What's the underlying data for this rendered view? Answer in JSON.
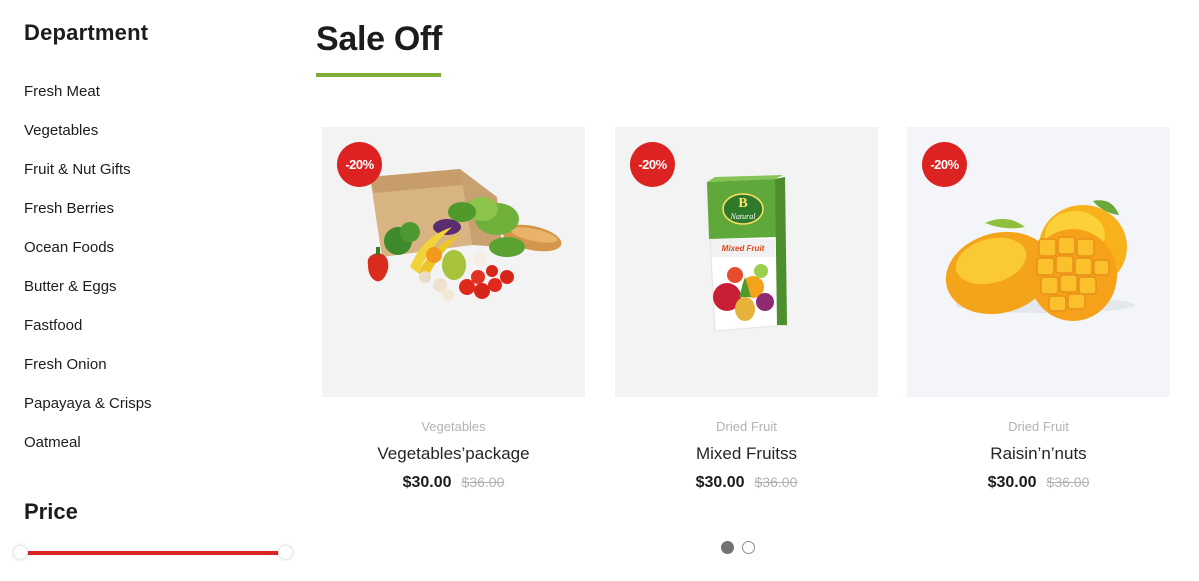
{
  "sidebar": {
    "department_title": "Department",
    "departments": [
      "Fresh Meat",
      "Vegetables",
      "Fruit & Nut Gifts",
      "Fresh Berries",
      "Ocean Foods",
      "Butter & Eggs",
      "Fastfood",
      "Fresh Onion",
      "Papayaya & Crisps",
      "Oatmeal"
    ],
    "price_title": "Price",
    "price_range_fill": 1.0
  },
  "main": {
    "section_title": "Sale Off",
    "products": [
      {
        "discount": "-20%",
        "category": "Vegetables",
        "name": "Vegetables’package",
        "price": "$30.00",
        "old_price": "$36.00",
        "image": "grocery-bag-image"
      },
      {
        "discount": "-20%",
        "category": "Dried Fruit",
        "name": "Mixed Fruitss",
        "price": "$30.00",
        "old_price": "$36.00",
        "image": "juice-carton-image"
      },
      {
        "discount": "-20%",
        "category": "Dried Fruit",
        "name": "Raisin’n’nuts",
        "price": "$30.00",
        "old_price": "$36.00",
        "image": "mango-image"
      }
    ],
    "carousel": {
      "pages": 2,
      "active_page": 1
    }
  },
  "colors": {
    "accent_green": "#7fad39",
    "badge_red": "#dd2222",
    "slider_red": "#dd2222",
    "text_dark": "#1c1c1c",
    "text_muted": "#b2b2b2"
  }
}
